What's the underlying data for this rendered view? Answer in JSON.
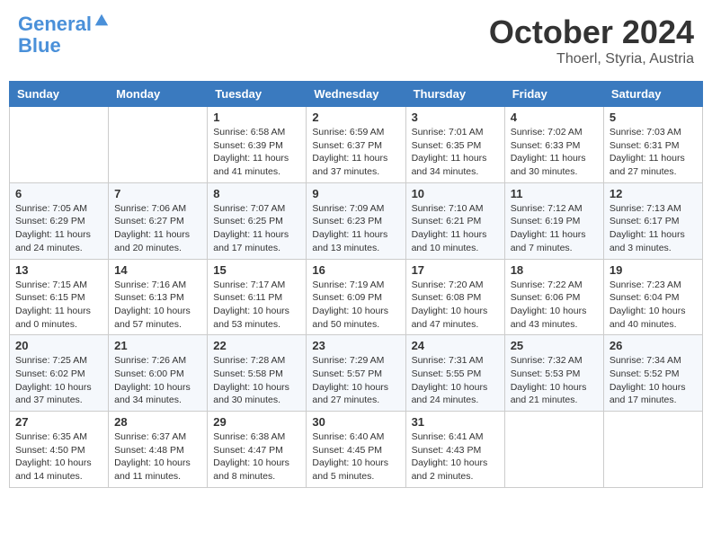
{
  "header": {
    "logo_line1": "General",
    "logo_line2": "Blue",
    "month_title": "October 2024",
    "location": "Thoerl, Styria, Austria"
  },
  "weekdays": [
    "Sunday",
    "Monday",
    "Tuesday",
    "Wednesday",
    "Thursday",
    "Friday",
    "Saturday"
  ],
  "weeks": [
    [
      null,
      null,
      {
        "day": "1",
        "sunrise": "Sunrise: 6:58 AM",
        "sunset": "Sunset: 6:39 PM",
        "daylight": "Daylight: 11 hours and 41 minutes."
      },
      {
        "day": "2",
        "sunrise": "Sunrise: 6:59 AM",
        "sunset": "Sunset: 6:37 PM",
        "daylight": "Daylight: 11 hours and 37 minutes."
      },
      {
        "day": "3",
        "sunrise": "Sunrise: 7:01 AM",
        "sunset": "Sunset: 6:35 PM",
        "daylight": "Daylight: 11 hours and 34 minutes."
      },
      {
        "day": "4",
        "sunrise": "Sunrise: 7:02 AM",
        "sunset": "Sunset: 6:33 PM",
        "daylight": "Daylight: 11 hours and 30 minutes."
      },
      {
        "day": "5",
        "sunrise": "Sunrise: 7:03 AM",
        "sunset": "Sunset: 6:31 PM",
        "daylight": "Daylight: 11 hours and 27 minutes."
      }
    ],
    [
      {
        "day": "6",
        "sunrise": "Sunrise: 7:05 AM",
        "sunset": "Sunset: 6:29 PM",
        "daylight": "Daylight: 11 hours and 24 minutes."
      },
      {
        "day": "7",
        "sunrise": "Sunrise: 7:06 AM",
        "sunset": "Sunset: 6:27 PM",
        "daylight": "Daylight: 11 hours and 20 minutes."
      },
      {
        "day": "8",
        "sunrise": "Sunrise: 7:07 AM",
        "sunset": "Sunset: 6:25 PM",
        "daylight": "Daylight: 11 hours and 17 minutes."
      },
      {
        "day": "9",
        "sunrise": "Sunrise: 7:09 AM",
        "sunset": "Sunset: 6:23 PM",
        "daylight": "Daylight: 11 hours and 13 minutes."
      },
      {
        "day": "10",
        "sunrise": "Sunrise: 7:10 AM",
        "sunset": "Sunset: 6:21 PM",
        "daylight": "Daylight: 11 hours and 10 minutes."
      },
      {
        "day": "11",
        "sunrise": "Sunrise: 7:12 AM",
        "sunset": "Sunset: 6:19 PM",
        "daylight": "Daylight: 11 hours and 7 minutes."
      },
      {
        "day": "12",
        "sunrise": "Sunrise: 7:13 AM",
        "sunset": "Sunset: 6:17 PM",
        "daylight": "Daylight: 11 hours and 3 minutes."
      }
    ],
    [
      {
        "day": "13",
        "sunrise": "Sunrise: 7:15 AM",
        "sunset": "Sunset: 6:15 PM",
        "daylight": "Daylight: 11 hours and 0 minutes."
      },
      {
        "day": "14",
        "sunrise": "Sunrise: 7:16 AM",
        "sunset": "Sunset: 6:13 PM",
        "daylight": "Daylight: 10 hours and 57 minutes."
      },
      {
        "day": "15",
        "sunrise": "Sunrise: 7:17 AM",
        "sunset": "Sunset: 6:11 PM",
        "daylight": "Daylight: 10 hours and 53 minutes."
      },
      {
        "day": "16",
        "sunrise": "Sunrise: 7:19 AM",
        "sunset": "Sunset: 6:09 PM",
        "daylight": "Daylight: 10 hours and 50 minutes."
      },
      {
        "day": "17",
        "sunrise": "Sunrise: 7:20 AM",
        "sunset": "Sunset: 6:08 PM",
        "daylight": "Daylight: 10 hours and 47 minutes."
      },
      {
        "day": "18",
        "sunrise": "Sunrise: 7:22 AM",
        "sunset": "Sunset: 6:06 PM",
        "daylight": "Daylight: 10 hours and 43 minutes."
      },
      {
        "day": "19",
        "sunrise": "Sunrise: 7:23 AM",
        "sunset": "Sunset: 6:04 PM",
        "daylight": "Daylight: 10 hours and 40 minutes."
      }
    ],
    [
      {
        "day": "20",
        "sunrise": "Sunrise: 7:25 AM",
        "sunset": "Sunset: 6:02 PM",
        "daylight": "Daylight: 10 hours and 37 minutes."
      },
      {
        "day": "21",
        "sunrise": "Sunrise: 7:26 AM",
        "sunset": "Sunset: 6:00 PM",
        "daylight": "Daylight: 10 hours and 34 minutes."
      },
      {
        "day": "22",
        "sunrise": "Sunrise: 7:28 AM",
        "sunset": "Sunset: 5:58 PM",
        "daylight": "Daylight: 10 hours and 30 minutes."
      },
      {
        "day": "23",
        "sunrise": "Sunrise: 7:29 AM",
        "sunset": "Sunset: 5:57 PM",
        "daylight": "Daylight: 10 hours and 27 minutes."
      },
      {
        "day": "24",
        "sunrise": "Sunrise: 7:31 AM",
        "sunset": "Sunset: 5:55 PM",
        "daylight": "Daylight: 10 hours and 24 minutes."
      },
      {
        "day": "25",
        "sunrise": "Sunrise: 7:32 AM",
        "sunset": "Sunset: 5:53 PM",
        "daylight": "Daylight: 10 hours and 21 minutes."
      },
      {
        "day": "26",
        "sunrise": "Sunrise: 7:34 AM",
        "sunset": "Sunset: 5:52 PM",
        "daylight": "Daylight: 10 hours and 17 minutes."
      }
    ],
    [
      {
        "day": "27",
        "sunrise": "Sunrise: 6:35 AM",
        "sunset": "Sunset: 4:50 PM",
        "daylight": "Daylight: 10 hours and 14 minutes."
      },
      {
        "day": "28",
        "sunrise": "Sunrise: 6:37 AM",
        "sunset": "Sunset: 4:48 PM",
        "daylight": "Daylight: 10 hours and 11 minutes."
      },
      {
        "day": "29",
        "sunrise": "Sunrise: 6:38 AM",
        "sunset": "Sunset: 4:47 PM",
        "daylight": "Daylight: 10 hours and 8 minutes."
      },
      {
        "day": "30",
        "sunrise": "Sunrise: 6:40 AM",
        "sunset": "Sunset: 4:45 PM",
        "daylight": "Daylight: 10 hours and 5 minutes."
      },
      {
        "day": "31",
        "sunrise": "Sunrise: 6:41 AM",
        "sunset": "Sunset: 4:43 PM",
        "daylight": "Daylight: 10 hours and 2 minutes."
      },
      null,
      null
    ]
  ]
}
